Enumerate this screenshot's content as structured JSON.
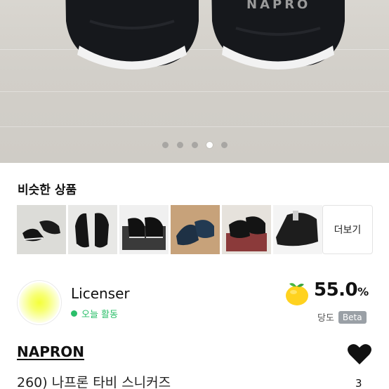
{
  "hero": {
    "carousel": {
      "count": 5,
      "active_index": 3
    }
  },
  "similar": {
    "title": "비슷한 상품",
    "thumbnails": [
      {
        "name": "similar-item-1"
      },
      {
        "name": "similar-item-2"
      },
      {
        "name": "similar-item-3"
      },
      {
        "name": "similar-item-4"
      },
      {
        "name": "similar-item-5"
      },
      {
        "name": "similar-item-6"
      }
    ],
    "more_label": "더보기"
  },
  "seller": {
    "name": "Licenser",
    "activity": "오늘 활동",
    "activity_color": "#2bbf6a",
    "score": "55.0",
    "score_unit": "%",
    "score_label": "당도",
    "beta_label": "Beta",
    "icon": "lemon-icon"
  },
  "product": {
    "brand": "NAPRON",
    "title": "260) 나프론 타비 스니커즈",
    "like_count": "3",
    "like_icon": "heart-icon"
  }
}
